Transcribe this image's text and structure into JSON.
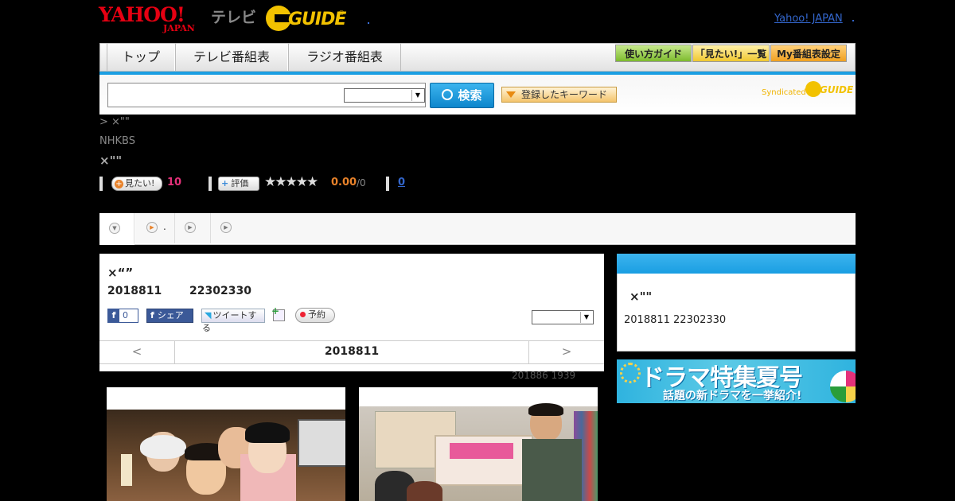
{
  "header": {
    "logo_yahoo": "YAHOO!",
    "logo_japan": "JAPAN",
    "logo_tv": "テレビ",
    "logo_guide": "GUIDE",
    "logo_reg": "®",
    "yahoo_japan_link": "Yahoo! JAPAN"
  },
  "nav": {
    "tabs": [
      "トップ",
      "テレビ番組表",
      "ラジオ番組表"
    ],
    "guide_button": "使い方ガイド",
    "mitai_button": "「見たい!」一覧",
    "my_button": "My番組表設定"
  },
  "search": {
    "placeholder": "",
    "select_value": "",
    "button_label": "検索",
    "keyword_button": "登録したキーワード",
    "syndicated": "Syndicated",
    "syndicated_logo": "GUIDE"
  },
  "program": {
    "breadcrumb": "> ×\"\"",
    "channel": "NHKBS",
    "title": "×\"\"",
    "mitai_label": "見たい!",
    "mitai_count": "10",
    "rating_label": "評価",
    "stars": "★★★★★",
    "rating_value": "0.00",
    "rating_total": "/0",
    "comment_count": "0"
  },
  "tabs": {
    "tab2_suffix": "."
  },
  "card": {
    "title": "×“”",
    "date": "2018811",
    "time": "22302330",
    "fb_count": "0",
    "share_label": "シェア",
    "tweet_label": "ツイートする",
    "reserve_label": "予約",
    "select_value": "",
    "prev": "<",
    "page_date": "2018811",
    "next": ">",
    "update_note": "201886  1939"
  },
  "sidebar": {
    "title": "×\"\"",
    "datetime": "2018811  22302330"
  },
  "banner": {
    "title": "ドラマ特集夏号",
    "subtitle": "話題の新ドラマを一挙紹介!"
  },
  "colors": {
    "accent_blue": "#1a9ee2",
    "pink": "#e5317a",
    "orange": "#e8822a",
    "logo_red": "#e60012",
    "guide_yellow": "#f2c200"
  }
}
